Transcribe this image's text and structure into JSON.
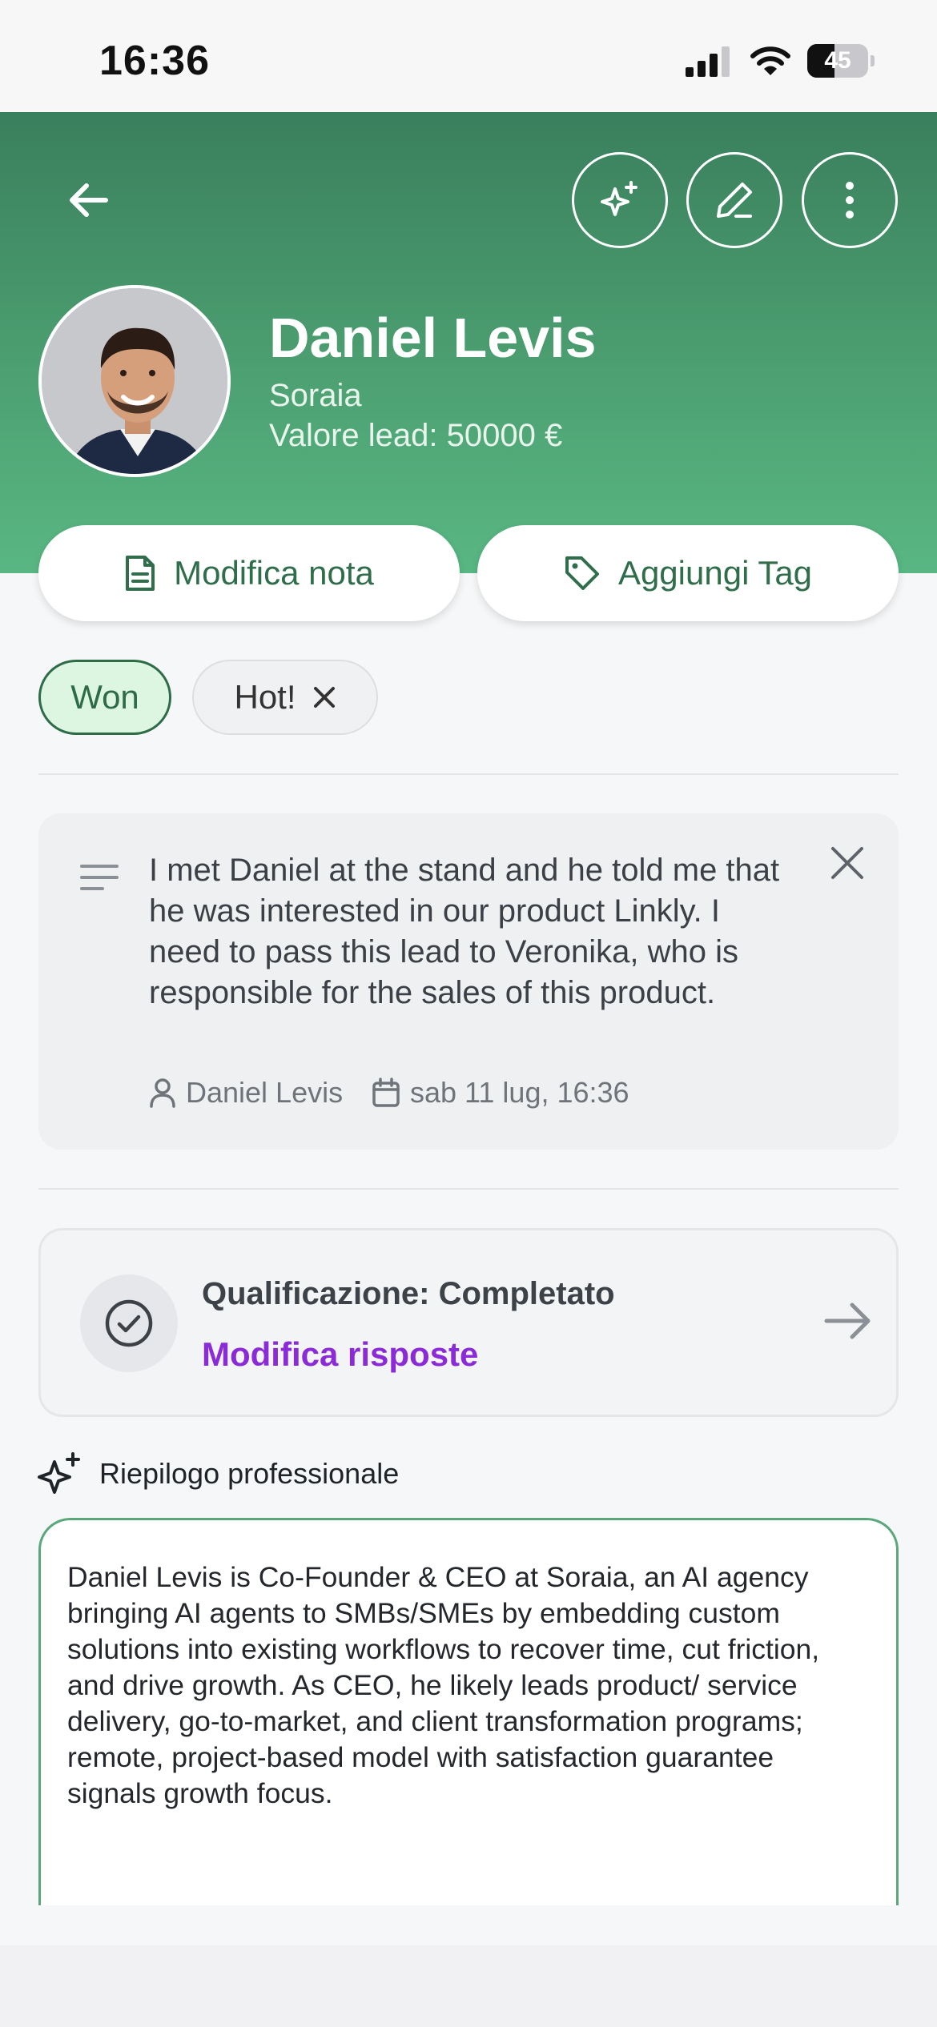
{
  "status_bar": {
    "time": "16:36",
    "battery": "45",
    "battery_level": 0.45
  },
  "header": {
    "back_icon": "arrow-left-icon",
    "actions": [
      {
        "icon": "sparkles-icon"
      },
      {
        "icon": "pencil-icon"
      },
      {
        "icon": "more-vertical-icon"
      }
    ]
  },
  "contact": {
    "name": "Daniel Levis",
    "company": "Soraia",
    "lead_value": "Valore lead: 50000 €"
  },
  "buttons": {
    "edit_note": "Modifica nota",
    "add_tag": "Aggiungi Tag"
  },
  "tags": [
    {
      "label": "Won"
    },
    {
      "label": "Hot!"
    }
  ],
  "note": {
    "text": "I met Daniel at the stand and he told me that he was interested in our product Linkly. I need to pass this lead to Veronika, who is responsible for the sales of this product.",
    "author": "Daniel Levis",
    "date": "sab 11 lug, 16:36"
  },
  "qualification": {
    "title": "Qualificazione: Completato",
    "link": "Modifica risposte"
  },
  "summary": {
    "title": "Riepilogo professionale",
    "text": "Daniel Levis is Co-Founder & CEO at Soraia, an AI agency bringing AI agents to SMBs/SMEs by embedding custom solutions into existing workflows to recover time, cut friction, and drive growth. As CEO, he likely leads product/ service delivery, go-to-market, and client transformation programs; remote, project-based model with satisfaction guarantee signals growth focus."
  },
  "colors": {
    "header_green_top": "#3a7f5d",
    "header_green_bottom": "#59b783",
    "accent_green": "#2f6d4b",
    "link_purple": "#8b2bd8",
    "summary_border": "#5aa77c"
  }
}
